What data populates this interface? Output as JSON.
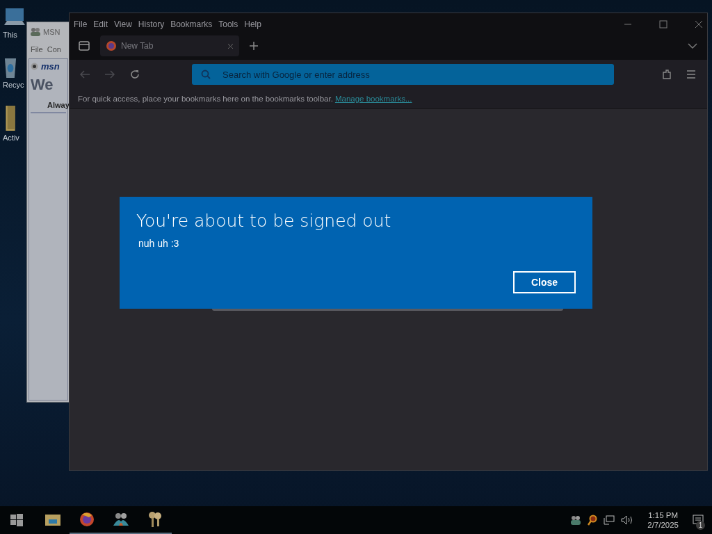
{
  "desktop": {
    "icons": [
      {
        "kind": "computer",
        "label": "This"
      },
      {
        "kind": "recycle",
        "label": "Recyc"
      },
      {
        "kind": "folder",
        "label": "Activ"
      }
    ]
  },
  "msn_window": {
    "title": "MSN",
    "menu": [
      "File",
      "Con"
    ],
    "logo": "msn",
    "heading": "We",
    "button": "Alway"
  },
  "browser": {
    "menu": [
      "File",
      "Edit",
      "View",
      "History",
      "Bookmarks",
      "Tools",
      "Help"
    ],
    "tabs": [
      {
        "label": "New Tab",
        "selected": true
      }
    ],
    "search": {
      "placeholder": "Search with Google or enter address"
    },
    "bookmarks_bar": {
      "text": "For quick access, place your bookmarks here on the bookmarks toolbar.",
      "link": "Manage bookmarks..."
    }
  },
  "dialog": {
    "title": "You're about to be signed out",
    "message": "nuh uh :3",
    "button": "Close"
  },
  "taskbar": {
    "apps": [
      {
        "kind": "folder",
        "running": false
      },
      {
        "kind": "firefox",
        "running": true
      },
      {
        "kind": "people",
        "running": true
      },
      {
        "kind": "keys",
        "running": true
      }
    ],
    "tray": [
      {
        "kind": "people"
      },
      {
        "kind": "magnifier"
      },
      {
        "kind": "network"
      },
      {
        "kind": "volume"
      }
    ],
    "time": "1:15 PM",
    "date": "2/7/2025",
    "notifications": "1"
  }
}
